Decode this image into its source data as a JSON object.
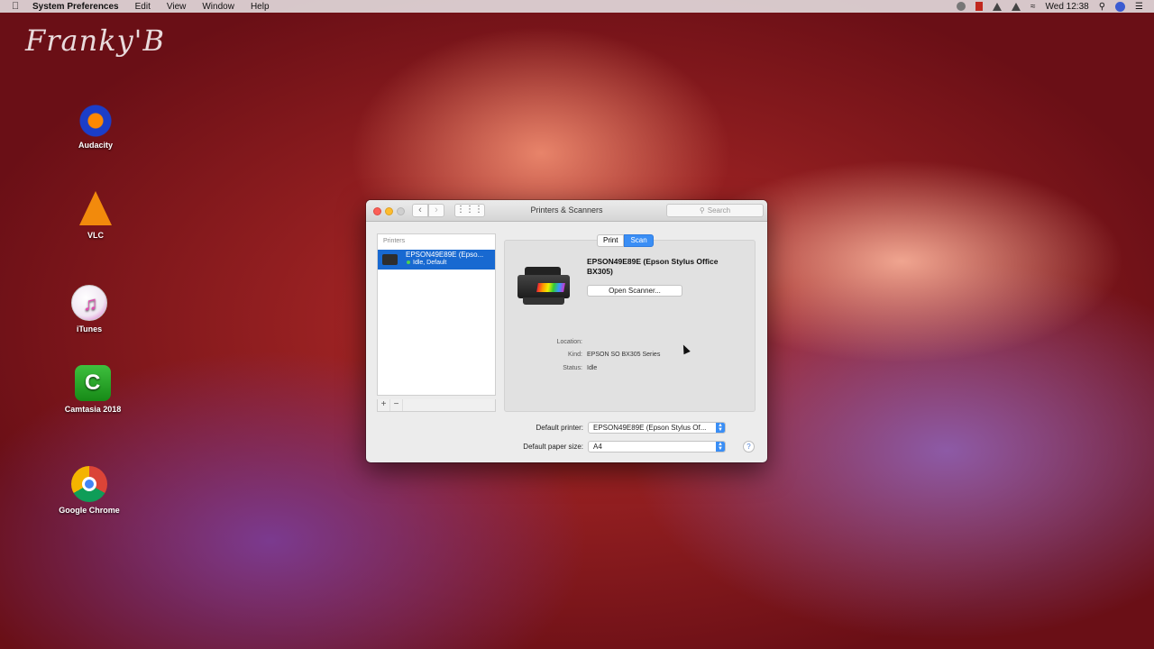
{
  "menubar": {
    "app_name": "System Preferences",
    "items": [
      "Edit",
      "View",
      "Window",
      "Help"
    ],
    "clock": "Wed 12:38"
  },
  "watermark": "Franky'B",
  "desktop_icons": [
    {
      "label": "Audacity"
    },
    {
      "label": "VLC"
    },
    {
      "label": "iTunes"
    },
    {
      "label": "Camtasia 2018"
    },
    {
      "label": "Google Chrome"
    }
  ],
  "window": {
    "title": "Printers & Scanners",
    "search_placeholder": "Search",
    "list_header": "Printers",
    "printer": {
      "name": "EPSON49E89E (Epso...",
      "status": "Idle, Default"
    },
    "tabs": {
      "print": "Print",
      "scan": "Scan",
      "selected": "Scan"
    },
    "device_name": "EPSON49E89E (Epson Stylus Office BX305)",
    "open_scanner_label": "Open Scanner...",
    "info": {
      "location_label": "Location:",
      "location_value": "",
      "kind_label": "Kind:",
      "kind_value": "EPSON SO BX305 Series",
      "status_label": "Status:",
      "status_value": "Idle"
    },
    "default_printer_label": "Default printer:",
    "default_printer_value": "EPSON49E89E (Epson Stylus Of...",
    "paper_size_label": "Default paper size:",
    "paper_size_value": "A4",
    "add_label": "+",
    "remove_label": "−",
    "help_label": "?"
  },
  "colors": {
    "selection_blue": "#1869d1",
    "segment_blue": "#3a8ef5"
  }
}
